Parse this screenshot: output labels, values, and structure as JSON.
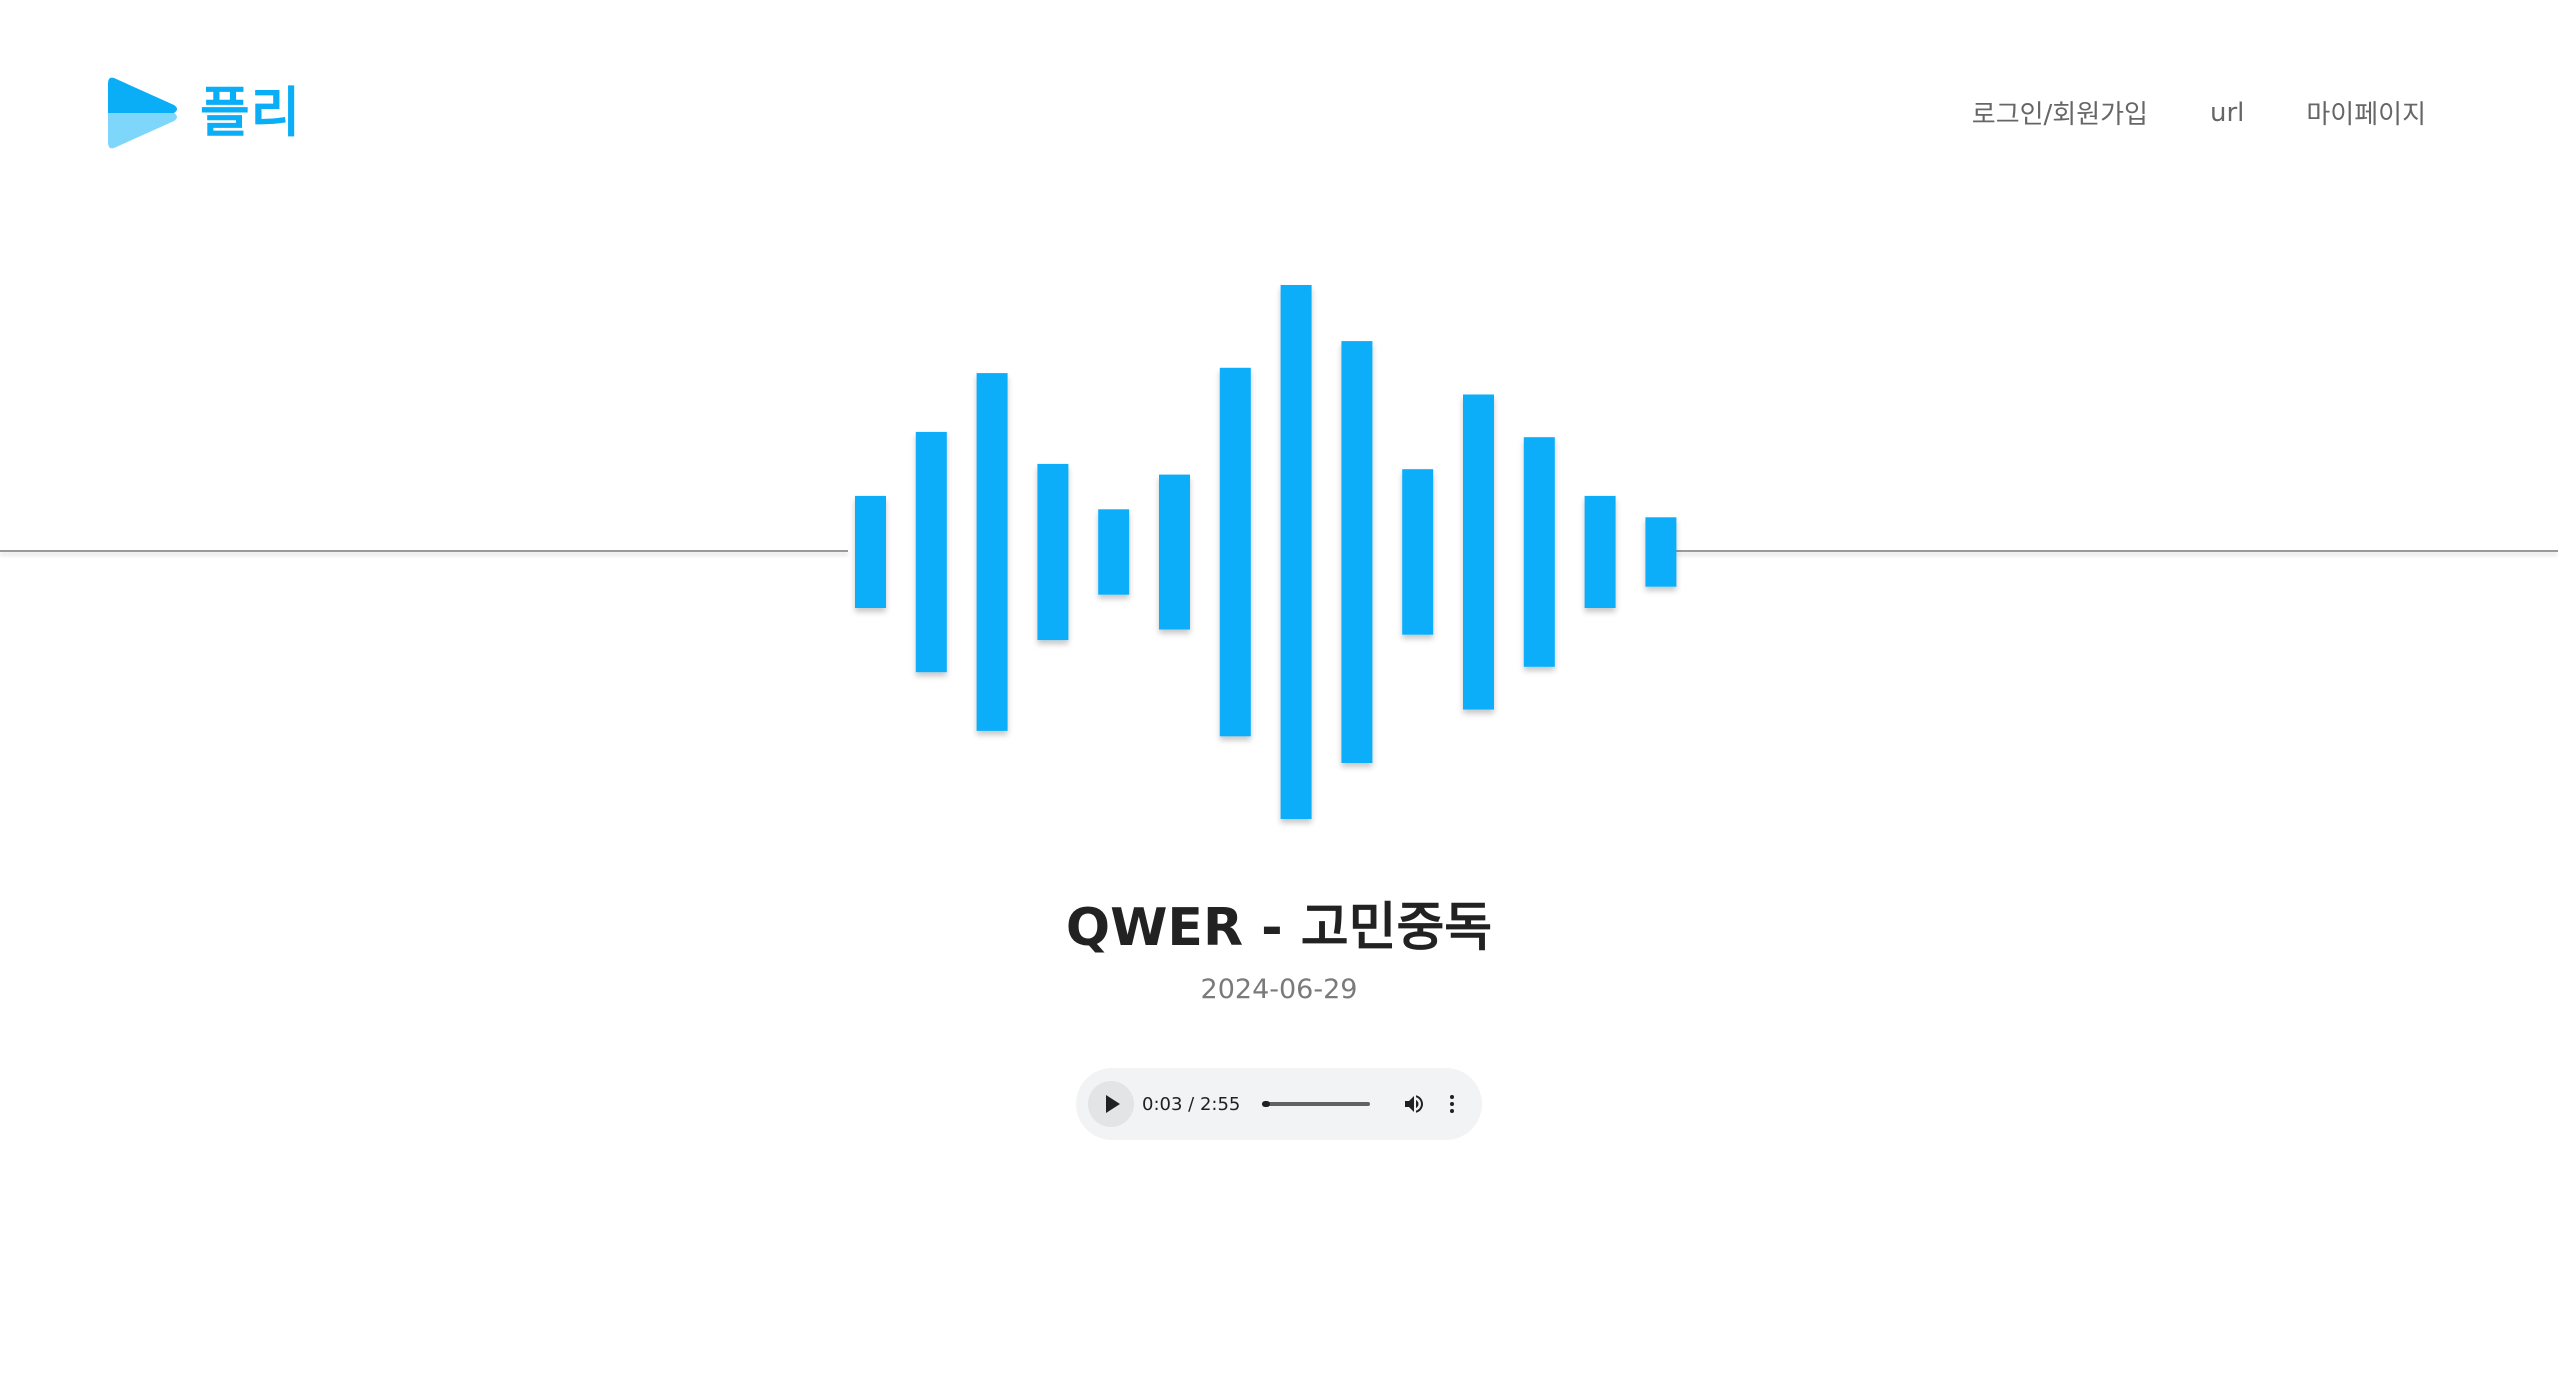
{
  "brand": {
    "name": "플리",
    "accent_color": "#0aaef7",
    "icon": "play-logo-icon"
  },
  "nav": {
    "items": [
      {
        "label": "로그인/회원가입"
      },
      {
        "label": "url"
      },
      {
        "label": "마이페이지"
      }
    ]
  },
  "waveform": {
    "color": "#09aef9",
    "bar_levels": [
      0.21,
      0.45,
      0.67,
      0.33,
      0.16,
      0.29,
      0.69,
      1.0,
      0.79,
      0.31,
      0.59,
      0.43,
      0.21,
      0.13
    ]
  },
  "song": {
    "title": "QWER - 고민중독",
    "date": "2024-06-29"
  },
  "player": {
    "current_time": "0:03",
    "separator": " / ",
    "duration": "2:55",
    "progress_fraction": 0.017,
    "icons": [
      "play-icon",
      "volume-icon",
      "more-options-icon"
    ]
  }
}
